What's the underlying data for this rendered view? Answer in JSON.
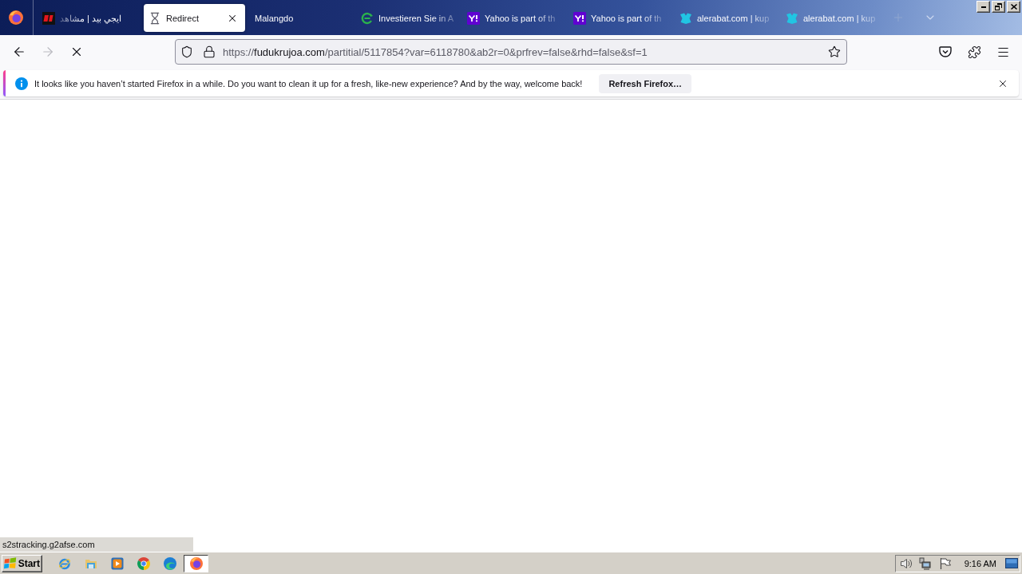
{
  "tabs": [
    {
      "title": "ايجي بيد | مشاهد",
      "kind": "tile",
      "selected": false,
      "faded": true
    },
    {
      "title": "Redirect",
      "kind": "hourglass",
      "selected": true,
      "faded": false
    },
    {
      "title": "Malangdo",
      "kind": "none",
      "selected": false,
      "faded": false
    },
    {
      "title": "Investieren Sie in A",
      "kind": "ring",
      "selected": false,
      "faded": true
    },
    {
      "title": "Yahoo is part of th",
      "kind": "square",
      "selected": false,
      "faded": true
    },
    {
      "title": "Yahoo is part of th",
      "kind": "square",
      "selected": false,
      "faded": true
    },
    {
      "title": "alerabat.com | kup",
      "kind": "bird",
      "selected": false,
      "faded": true
    },
    {
      "title": "alerabat.com | kup",
      "kind": "bird",
      "selected": false,
      "faded": true
    }
  ],
  "navigation": {
    "back": {
      "disabled": false
    },
    "forward": {
      "disabled": true
    },
    "loading": true
  },
  "address_bar": {
    "scheme": "https://",
    "host": "fudukrujoa.com",
    "path": "/partitial/5117854?var=6118780&ab2r=0&prfrev=false&rhd=false&sf=1"
  },
  "notification": {
    "message": "It looks like you haven’t started Firefox in a while. Do you want to clean it up for a fresh, like-new experience? And by the way, welcome back!",
    "button": "Refresh Firefox…"
  },
  "status_text": "s2stracking.g2afse.com",
  "taskbar": {
    "start": "Start",
    "apps": [
      {
        "kind": "ie",
        "active": false
      },
      {
        "kind": "folder",
        "active": false
      },
      {
        "kind": "media",
        "active": false
      },
      {
        "kind": "chrome",
        "active": false
      },
      {
        "kind": "edge",
        "active": false
      },
      {
        "kind": "firefox",
        "active": true
      }
    ],
    "clock": "9:16 AM"
  }
}
